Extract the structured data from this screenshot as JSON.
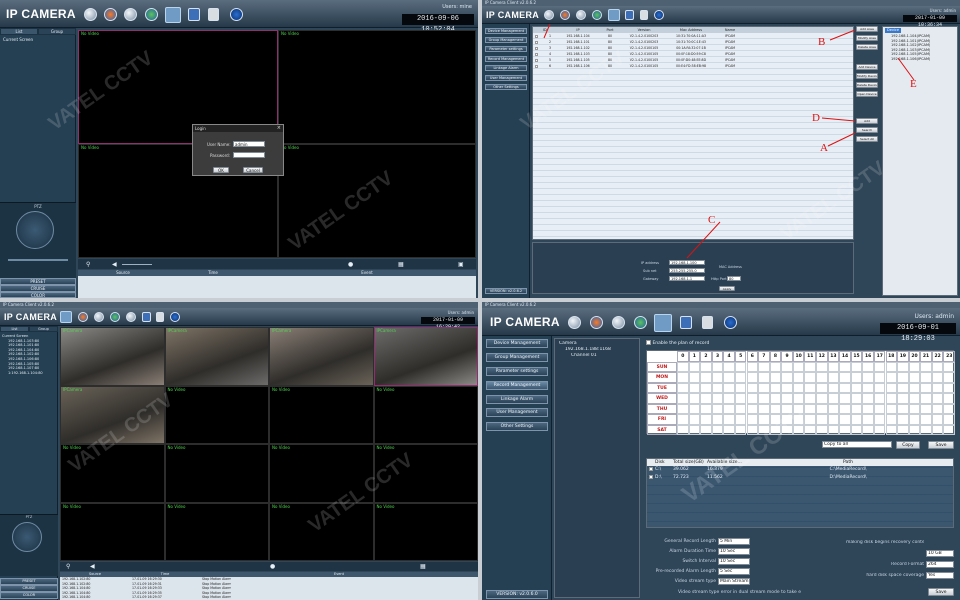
{
  "q1": {
    "logo": "IP CAMERA",
    "datetime": "2016-09-06 10:52:04",
    "user": "Users: mine",
    "tabs": [
      "List",
      "Group"
    ],
    "tree_item": "Current Screen",
    "cells": [
      "No Video",
      "No Video",
      "No Video",
      "No Video"
    ],
    "ptz": "PTZ",
    "bottom_items": [
      "PRESET",
      "CRUISE",
      "COLOR"
    ],
    "event_cols": [
      "Source",
      "Time",
      "Event"
    ],
    "login": {
      "title": "Login",
      "user_label": "User Name:",
      "user_value": "admin",
      "pass_label": "Password:",
      "ok": "OK",
      "cancel": "Cancel"
    }
  },
  "q2": {
    "titlebar": "IP Camera Client v2.0.6.2",
    "logo": "IP CAMERA",
    "datetime": "2017-01-09 10:36:34",
    "user": "Users: admin",
    "nav": [
      "Device Management",
      "Group Management",
      "Parameter settings",
      "Record Management",
      "Linkage Alarm",
      "User Management",
      "Other Settings"
    ],
    "version": "VERSION: v2.0.6.2",
    "cols": [
      "",
      "ID",
      "IP",
      "Port",
      "Version",
      "Mac Address",
      "Name"
    ],
    "rows": [
      [
        "1",
        "192.168.1.104",
        "80",
        "V2.1.4.2.0100203",
        "10:31:70:0A:11:A3",
        "IPCAM"
      ],
      [
        "2",
        "192.168.1.101",
        "80",
        "V2.1.4.2.0100203",
        "10:31:70:0C:1E:43",
        "IPCAM"
      ],
      [
        "3",
        "192.168.1.102",
        "80",
        "V2.1.4.2.0100105",
        "00:1A:FA:32:07:1B",
        "IPCAM"
      ],
      [
        "4",
        "192.168.1.103",
        "80",
        "V2.1.4.2.0100105",
        "00:0F:18:D0:59:C8",
        "IPCAM"
      ],
      [
        "5",
        "192.168.1.105",
        "80",
        "V2.1.4.2.0100105",
        "00:0F:D0:48:EE:8D",
        "IPCAM"
      ],
      [
        "6",
        "192.168.1.106",
        "80",
        "V2.1.4.2.0100105",
        "00:E4:FD:38:EB:98",
        "IPCAM"
      ]
    ],
    "right_btns_top": [
      "Add Area",
      "Modify Area",
      "Delete Area"
    ],
    "right_btns_mid": [
      "Add Device",
      "Modify Device",
      "Delete Device",
      "Open Device"
    ],
    "right_btns_bot": [
      "Add",
      "Search",
      "Select All"
    ],
    "tree_root": "Device",
    "tree_items": [
      "192.168.1.104(IPCAM)",
      "192.168.1.101(IPCAM)",
      "192.168.1.102(IPCAM)",
      "192.168.1.103(IPCAM)",
      "192.168.1.105(IPCAM)",
      "192.168.1.106(IPCAM)"
    ],
    "form": {
      "ip_label": "IP address",
      "ip_value": "192.168.1.100",
      "mask_label": "Sub net",
      "mask_value": "255.255.255.0",
      "gw_label": "Gateway",
      "gw_value": "192.168.1.1",
      "mac_label": "MAC Address",
      "port_label": "Http Port",
      "port_value": "80",
      "apply": "Apply"
    },
    "annotations": [
      "B",
      "D",
      "A",
      "C",
      "E"
    ]
  },
  "q3": {
    "titlebar": "IP Camera Client v2.0.6.2",
    "logo": "IP CAMERA",
    "datetime": "2017-01-09 16:29:42",
    "user": "Users: admin",
    "tabs": [
      "List",
      "Group"
    ],
    "tree_root": "Current Screen",
    "tree_items": [
      "192.168.1.103:80",
      "192.168.1.101:80",
      "192.168.1.104:80",
      "192.168.1.102:80",
      "192.168.1.106:80",
      "192.168.1.105:80",
      "192.168.1.107:80",
      "1:192.168.1.104:80"
    ],
    "cells": [
      "IPCamera",
      "IPCamera",
      "IPCamera",
      "IPCamera",
      "IPCamera",
      "No Video",
      "No Video",
      "No Video",
      "No Video",
      "No Video",
      "No Video",
      "No Video",
      "No Video",
      "No Video",
      "No Video",
      "No Video"
    ],
    "ptz": "PTZ",
    "bottom_items": [
      "PRESET",
      "CRUISE",
      "COLOR"
    ],
    "event_cols": [
      "Source",
      "Time",
      "Event"
    ],
    "events": [
      [
        "192.168.1.102:80",
        "17-01-09 16:29:30",
        "Stop Motion Alarm"
      ],
      [
        "192.168.1.102:80",
        "17-01-09 16:29:31",
        "Stop Motion Alarm"
      ],
      [
        "192.168.1.104:80",
        "17-01-09 16:29:33",
        "Stop Motion Alarm"
      ],
      [
        "192.168.1.104:80",
        "17-01-09 16:29:35",
        "Stop Motion Alarm"
      ],
      [
        "192.168.1.104:80",
        "17-01-09 16:29:37",
        "Stop Motion Alarm"
      ]
    ]
  },
  "q4": {
    "titlebar": "IP Camera Client v2.0.6.2",
    "logo": "IP CAMERA",
    "datetime": "2016-09-01 18:29:03",
    "user": "Users: admin",
    "nav": [
      "Device Management",
      "Group Management",
      "Parameter settings",
      "Record Management",
      "Linkage Alarm",
      "User Management",
      "Other Settings"
    ],
    "version": "VERSION: v2.0.6.0",
    "tree_root": "Camera",
    "tree_child": "192.168.1.188:1168",
    "tree_leaf": "Channel 01",
    "enable_label": "Enable the plan of record",
    "hours": [
      "0",
      "1",
      "2",
      "3",
      "4",
      "5",
      "6",
      "7",
      "8",
      "9",
      "10",
      "11",
      "12",
      "13",
      "14",
      "15",
      "16",
      "17",
      "18",
      "19",
      "20",
      "21",
      "22",
      "23"
    ],
    "days": [
      "SUN",
      "MON",
      "TUE",
      "WED",
      "THU",
      "FRI",
      "SAT"
    ],
    "copy_select": "Copy to all",
    "copy_btn": "Copy",
    "save_btn": "Save",
    "disk_cols": [
      "Disk",
      "Total size(GB)",
      "Available size...",
      "Path"
    ],
    "disks": [
      [
        "C:\\",
        "39.062",
        "16.379",
        "C:\\MediaRecord\\"
      ],
      [
        "D:\\",
        "72.723",
        "11.562",
        "D:\\MediaRecord\\"
      ]
    ],
    "settings": [
      {
        "label": "General Record Length",
        "value": "5 Min"
      },
      {
        "label": "Alarm Duration Time",
        "value": "10 Sec"
      },
      {
        "label": "Switch Interval",
        "value": "10 Sec"
      },
      {
        "label": "Pre-recorded Alarm Length",
        "value": "5 Sec"
      },
      {
        "label": "Video stream type",
        "value": "Main Stream"
      }
    ],
    "stream_note": "Video stream type error in dual stream mode to take e",
    "right_settings": [
      {
        "label": "making disk begins recovery conten",
        "value": ""
      },
      {
        "label": "",
        "value": "10 GB"
      },
      {
        "label": "Record Format",
        "value": "264"
      },
      {
        "label": "hard disk space coverage",
        "value": "Yes"
      }
    ],
    "save_btn2": "Save"
  },
  "watermark": "VATEL CCTV",
  "colors": {
    "bg": "#2f4658",
    "accent": "#6f9bc4",
    "alarm_green": "#51d451",
    "annotation_red": "#dd1111"
  }
}
